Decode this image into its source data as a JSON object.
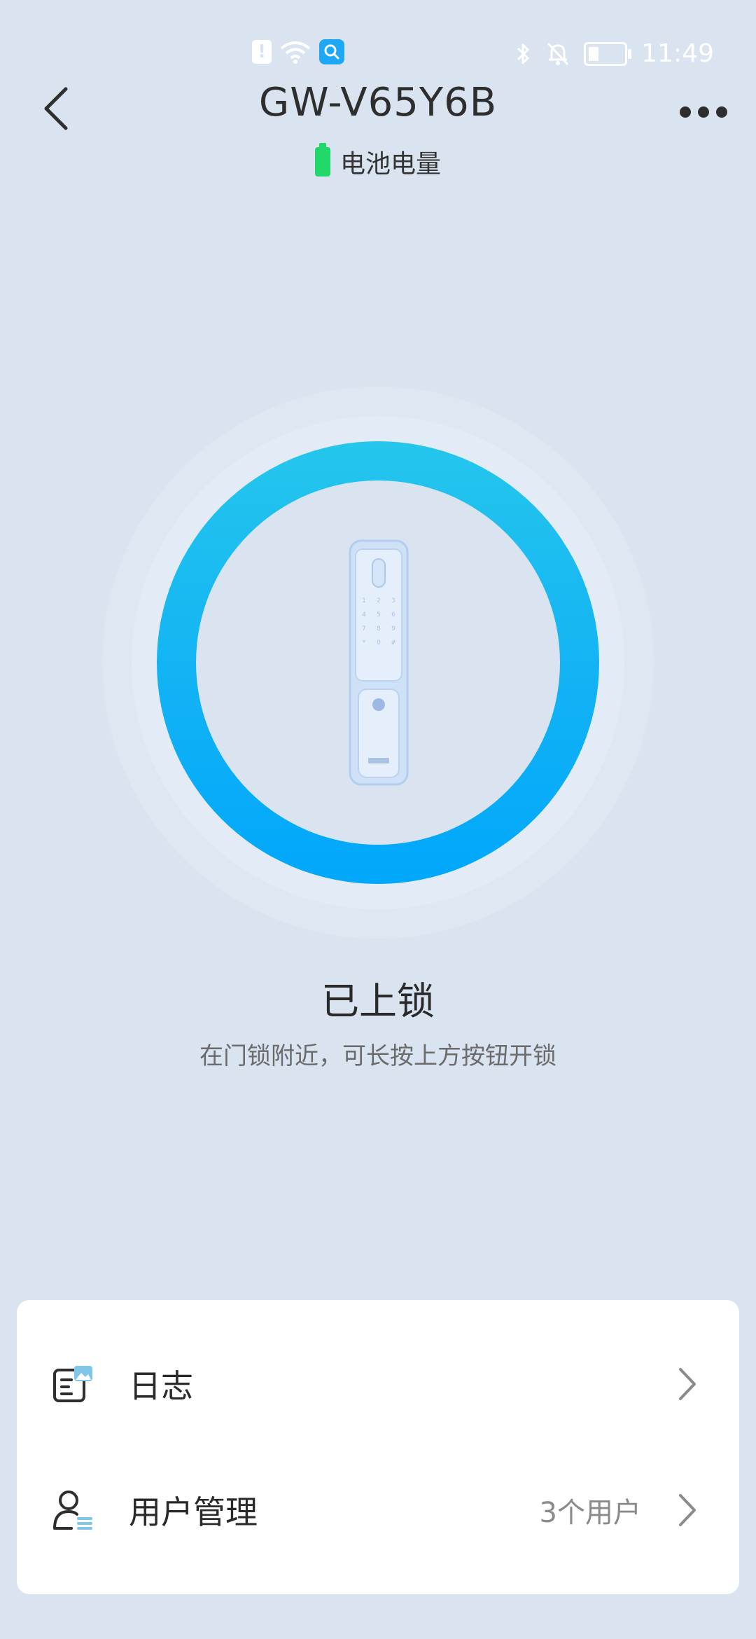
{
  "status_bar": {
    "time": "11:49",
    "left_icons": [
      "alert-icon",
      "wifi-icon",
      "search-app-icon"
    ],
    "right_icons": [
      "bluetooth-icon",
      "mute-bell-icon",
      "battery-icon"
    ]
  },
  "header": {
    "title": "GW-V65Y6B",
    "back_icon": "chevron-left-icon",
    "more_icon": "more-dots-icon"
  },
  "battery": {
    "label": "电池电量",
    "color": "#22d86a"
  },
  "lock": {
    "status": "已上锁",
    "hint": "在门锁附近，可长按上方按钮开锁",
    "ring_colors": [
      "#25c6ec",
      "#00a7fb"
    ]
  },
  "menu": {
    "items": [
      {
        "label": "日志",
        "value": "",
        "icon": "log-icon"
      },
      {
        "label": "用户管理",
        "value": "3个用户",
        "icon": "user-manage-icon"
      }
    ]
  }
}
